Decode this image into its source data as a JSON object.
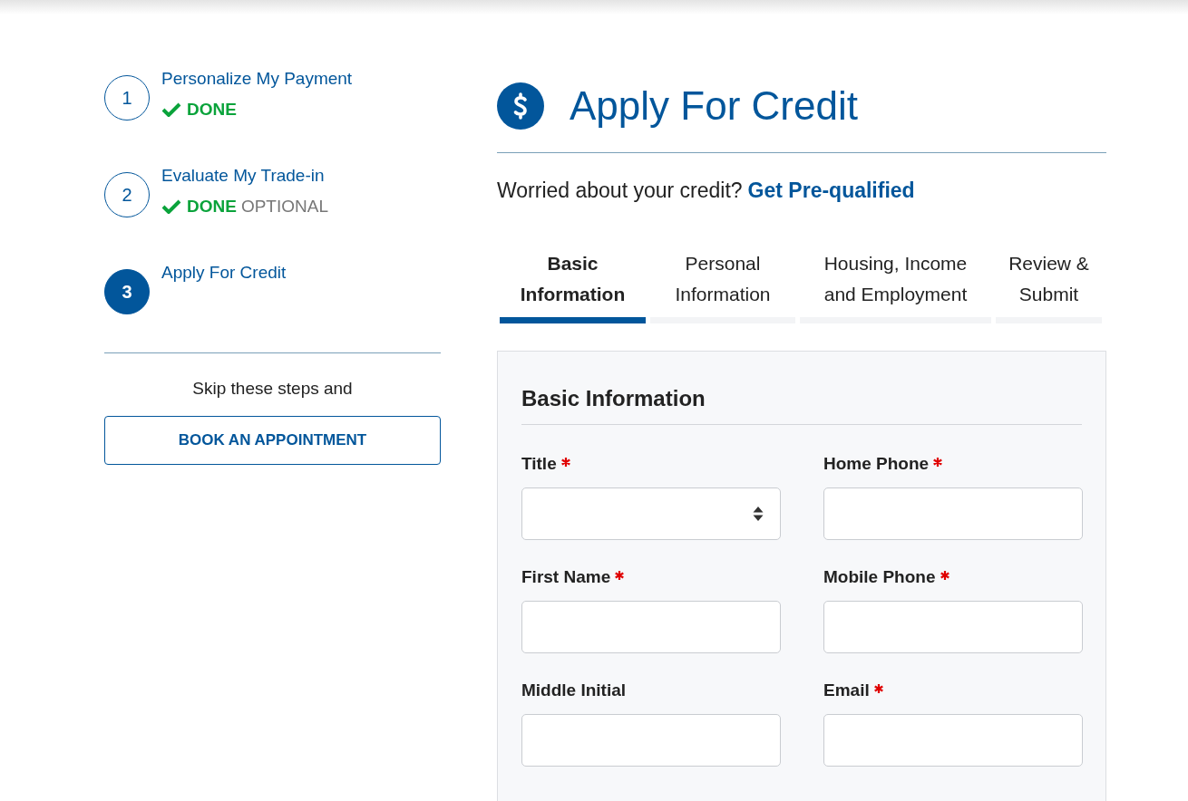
{
  "steps": [
    {
      "number": "1",
      "title": "Personalize My Payment",
      "active": false,
      "status": {
        "done": true,
        "label": "DONE"
      }
    },
    {
      "number": "2",
      "title": "Evaluate My Trade-in",
      "active": false,
      "status": {
        "done": true,
        "label": "DONE",
        "note": "OPTIONAL"
      }
    },
    {
      "number": "3",
      "title": "Apply For Credit",
      "active": true
    }
  ],
  "skip_text": "Skip these steps and",
  "appointment_button": "BOOK AN APPOINTMENT",
  "page_title": "Apply For Credit",
  "prequalify": {
    "text": "Worried about your credit?",
    "link": "Get Pre-qualified"
  },
  "tabs": [
    {
      "label": "Basic Information",
      "selected": true
    },
    {
      "label": "Personal Information",
      "selected": false
    },
    {
      "label": "Housing, Income and Employment",
      "selected": false
    },
    {
      "label": "Review & Submit",
      "selected": false
    }
  ],
  "form": {
    "title": "Basic Information",
    "fields": [
      {
        "label": "Title",
        "required": true,
        "kind": "select"
      },
      {
        "label": "Home Phone",
        "required": true,
        "kind": "text"
      },
      {
        "label": "First Name",
        "required": true,
        "kind": "text"
      },
      {
        "label": "Mobile Phone",
        "required": true,
        "kind": "text"
      },
      {
        "label": "Middle Initial",
        "required": false,
        "kind": "text"
      },
      {
        "label": "Email",
        "required": true,
        "kind": "text"
      }
    ]
  }
}
